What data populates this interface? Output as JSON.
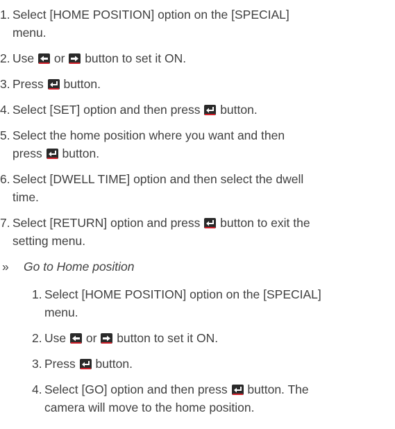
{
  "icons": {
    "left": "left-arrow-button-icon",
    "right": "right-arrow-button-icon",
    "enter": "enter-button-icon"
  },
  "colors": {
    "text": "#404040",
    "icon_bg": "#2a2a2a",
    "icon_underline": "#d0202a"
  },
  "steps": [
    {
      "num": "1.",
      "line1": "Select [HOME POSITION] option on the [SPECIAL]",
      "line2": "menu."
    },
    {
      "num": "2.",
      "a": "Use",
      "b": "or",
      "c": "button to set it ON."
    },
    {
      "num": "3.",
      "a": "Press",
      "c": "button."
    },
    {
      "num": "4.",
      "a": "Select [SET] option and then press",
      "c": "button."
    },
    {
      "num": "5.",
      "line1": "Select the home position where you want and then",
      "a": "press",
      "c": "button."
    },
    {
      "num": "6.",
      "line1": "Select [DWELL TIME] option and then select the dwell",
      "line2": "time."
    },
    {
      "num": "7.",
      "a": "Select [RETURN] option and press",
      "c": "button to exit the",
      "line2": "setting menu."
    }
  ],
  "bullet": {
    "mark": "»",
    "heading": "Go to Home position"
  },
  "sub_steps": [
    {
      "num": "1.",
      "line1": "Select [HOME POSITION] option on the [SPECIAL]",
      "line2": "menu."
    },
    {
      "num": "2.",
      "a": "Use",
      "b": "or",
      "c": "button to set it ON."
    },
    {
      "num": "3.",
      "a": "Press",
      "c": "button."
    },
    {
      "num": "4.",
      "a": "Select [GO] option and then press",
      "c": "button. The",
      "line2": "camera will move to the home position."
    }
  ]
}
